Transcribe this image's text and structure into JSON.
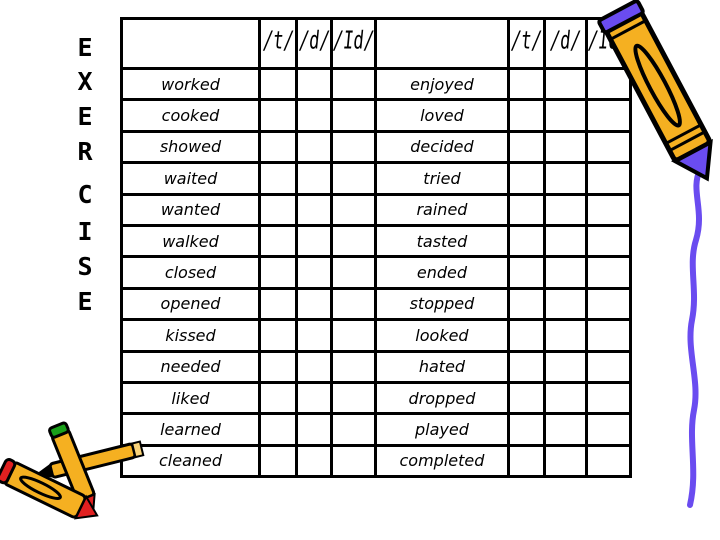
{
  "side_title": {
    "letters": [
      "E",
      "X",
      "E",
      "R",
      "C",
      "I",
      "S",
      "E"
    ]
  },
  "table": {
    "headers": {
      "left_word": "",
      "left_t": "/t/",
      "left_d": "/d/",
      "left_id": "/Id/",
      "right_word": "",
      "right_t": "/t/",
      "right_d": "/d/",
      "right_id": "/Id/"
    },
    "rows": [
      {
        "left": "worked",
        "right": "enjoyed"
      },
      {
        "left": "cooked",
        "right": "loved"
      },
      {
        "left": "showed",
        "right": "decided"
      },
      {
        "left": "waited",
        "right": "tried"
      },
      {
        "left": "wanted",
        "right": "rained"
      },
      {
        "left": "walked",
        "right": "tasted"
      },
      {
        "left": "closed",
        "right": "ended"
      },
      {
        "left": "opened",
        "right": "stopped"
      },
      {
        "left": "kissed",
        "right": "looked"
      },
      {
        "left": "needed",
        "right": "hated"
      },
      {
        "left": "liked",
        "right": "dropped"
      },
      {
        "left": "learned",
        "right": "played"
      },
      {
        "left": "cleaned",
        "right": "completed"
      }
    ]
  },
  "decorations": {
    "pencil_right": "pencil-icon",
    "pencils_left": "crossed-pencils-icon",
    "colors": {
      "pencil_body": "#f5b021",
      "pencil_accent": "#6a4cf0",
      "pencil_red": "#e02020",
      "pencil_green": "#1aa01a",
      "outline": "#000000"
    }
  }
}
